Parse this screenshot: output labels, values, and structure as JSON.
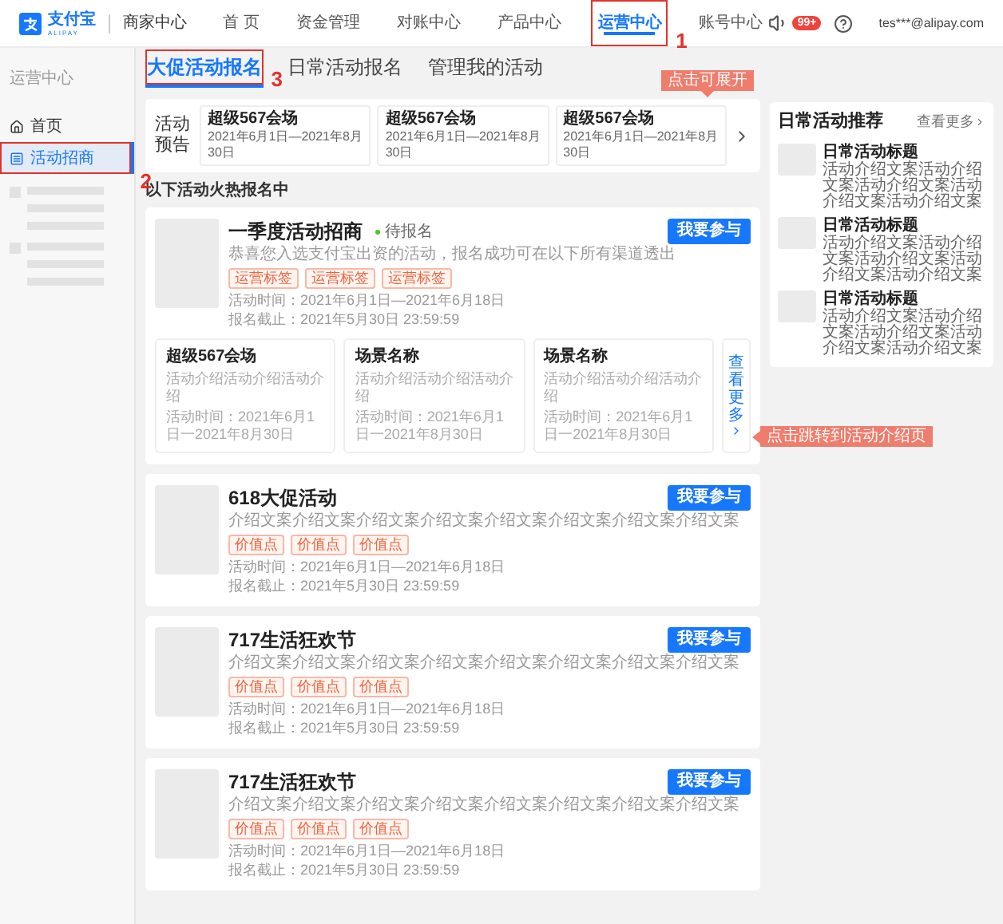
{
  "header": {
    "brand": "支付宝",
    "brand_sub": "ALIPAY",
    "product": "商家中心",
    "nav": [
      {
        "label": "首 页",
        "selected": false
      },
      {
        "label": "资金管理",
        "selected": false
      },
      {
        "label": "对账中心",
        "selected": false
      },
      {
        "label": "产品中心",
        "selected": false
      },
      {
        "label": "运营中心",
        "selected": true,
        "annotation": "1"
      },
      {
        "label": "账号中心",
        "selected": false
      }
    ],
    "badge": "99+",
    "user": "tes***@alipay.com"
  },
  "sidebar": {
    "title": "运营中心",
    "items": [
      {
        "label": "首页",
        "kind": "home",
        "selected": false
      },
      {
        "label": "活动招商",
        "kind": "list",
        "selected": true,
        "annotation": "2"
      }
    ]
  },
  "tabs": [
    {
      "label": "大促活动报名",
      "selected": true,
      "annotation": "3"
    },
    {
      "label": "日常活动报名",
      "selected": false
    },
    {
      "label": "管理我的活动",
      "selected": false
    }
  ],
  "preview": {
    "label": "活动预告",
    "callout": "点击可展开",
    "items": [
      {
        "title": "超级567会场",
        "dates": "2021年6月1日—2021年8月30日"
      },
      {
        "title": "超级567会场",
        "dates": "2021年6月1日—2021年8月30日"
      },
      {
        "title": "超级567会场",
        "dates": "2021年6月1日—2021年8月30日"
      }
    ]
  },
  "section_title": "以下活动火热报名中",
  "activities": [
    {
      "title": "一季度活动招商",
      "status": "待报名",
      "description": "恭喜您入选支付宝出资的活动，报名成功可在以下所有渠道透出",
      "tags": [
        "运营标签",
        "运营标签",
        "运营标签"
      ],
      "time": "活动时间：2021年6月1日—2021年6月18日",
      "deadline": "报名截止：2021年5月30日 23:59:59",
      "button": "我要参与",
      "venues": [
        {
          "title": "超级567会场",
          "intro": "活动介绍活动介绍活动介绍",
          "time": "活动时间：2021年6月1日一2021年8月30日"
        },
        {
          "title": "场景名称",
          "intro": "活动介绍活动介绍活动介绍",
          "time": "活动时间：2021年6月1日一2021年8月30日"
        },
        {
          "title": "场景名称",
          "intro": "活动介绍活动介绍活动介绍",
          "time": "活动时间：2021年6月1日一2021年8月30日"
        }
      ],
      "more": "查看更多",
      "more_callout": "点击跳转到活动介绍页"
    },
    {
      "title": "618大促活动",
      "description": "介绍文案介绍文案介绍文案介绍文案介绍文案介绍文案介绍文案介绍文案",
      "tags": [
        "价值点",
        "价值点",
        "价值点"
      ],
      "time": "活动时间：2021年6月1日—2021年6月18日",
      "deadline": "报名截止：2021年5月30日 23:59:59",
      "button": "我要参与"
    },
    {
      "title": "717生活狂欢节",
      "description": "介绍文案介绍文案介绍文案介绍文案介绍文案介绍文案介绍文案介绍文案",
      "tags": [
        "价值点",
        "价值点",
        "价值点"
      ],
      "time": "活动时间：2021年6月1日—2021年6月18日",
      "deadline": "报名截止：2021年5月30日 23:59:59",
      "button": "我要参与"
    },
    {
      "title": "717生活狂欢节",
      "description": "介绍文案介绍文案介绍文案介绍文案介绍文案介绍文案介绍文案介绍文案",
      "tags": [
        "价值点",
        "价值点",
        "价值点"
      ],
      "time": "活动时间：2021年6月1日—2021年6月18日",
      "deadline": "报名截止：2021年5月30日 23:59:59",
      "button": "我要参与"
    }
  ],
  "recommend": {
    "title": "日常活动推荐",
    "more": "查看更多",
    "items": [
      {
        "title": "日常活动标题",
        "description": "活动介绍文案活动介绍文案活动介绍文案活动介绍文案活动介绍文案"
      },
      {
        "title": "日常活动标题",
        "description": "活动介绍文案活动介绍文案活动介绍文案活动介绍文案活动介绍文案"
      },
      {
        "title": "日常活动标题",
        "description": "活动介绍文案活动介绍文案活动介绍文案活动介绍文案活动介绍文案"
      }
    ]
  }
}
